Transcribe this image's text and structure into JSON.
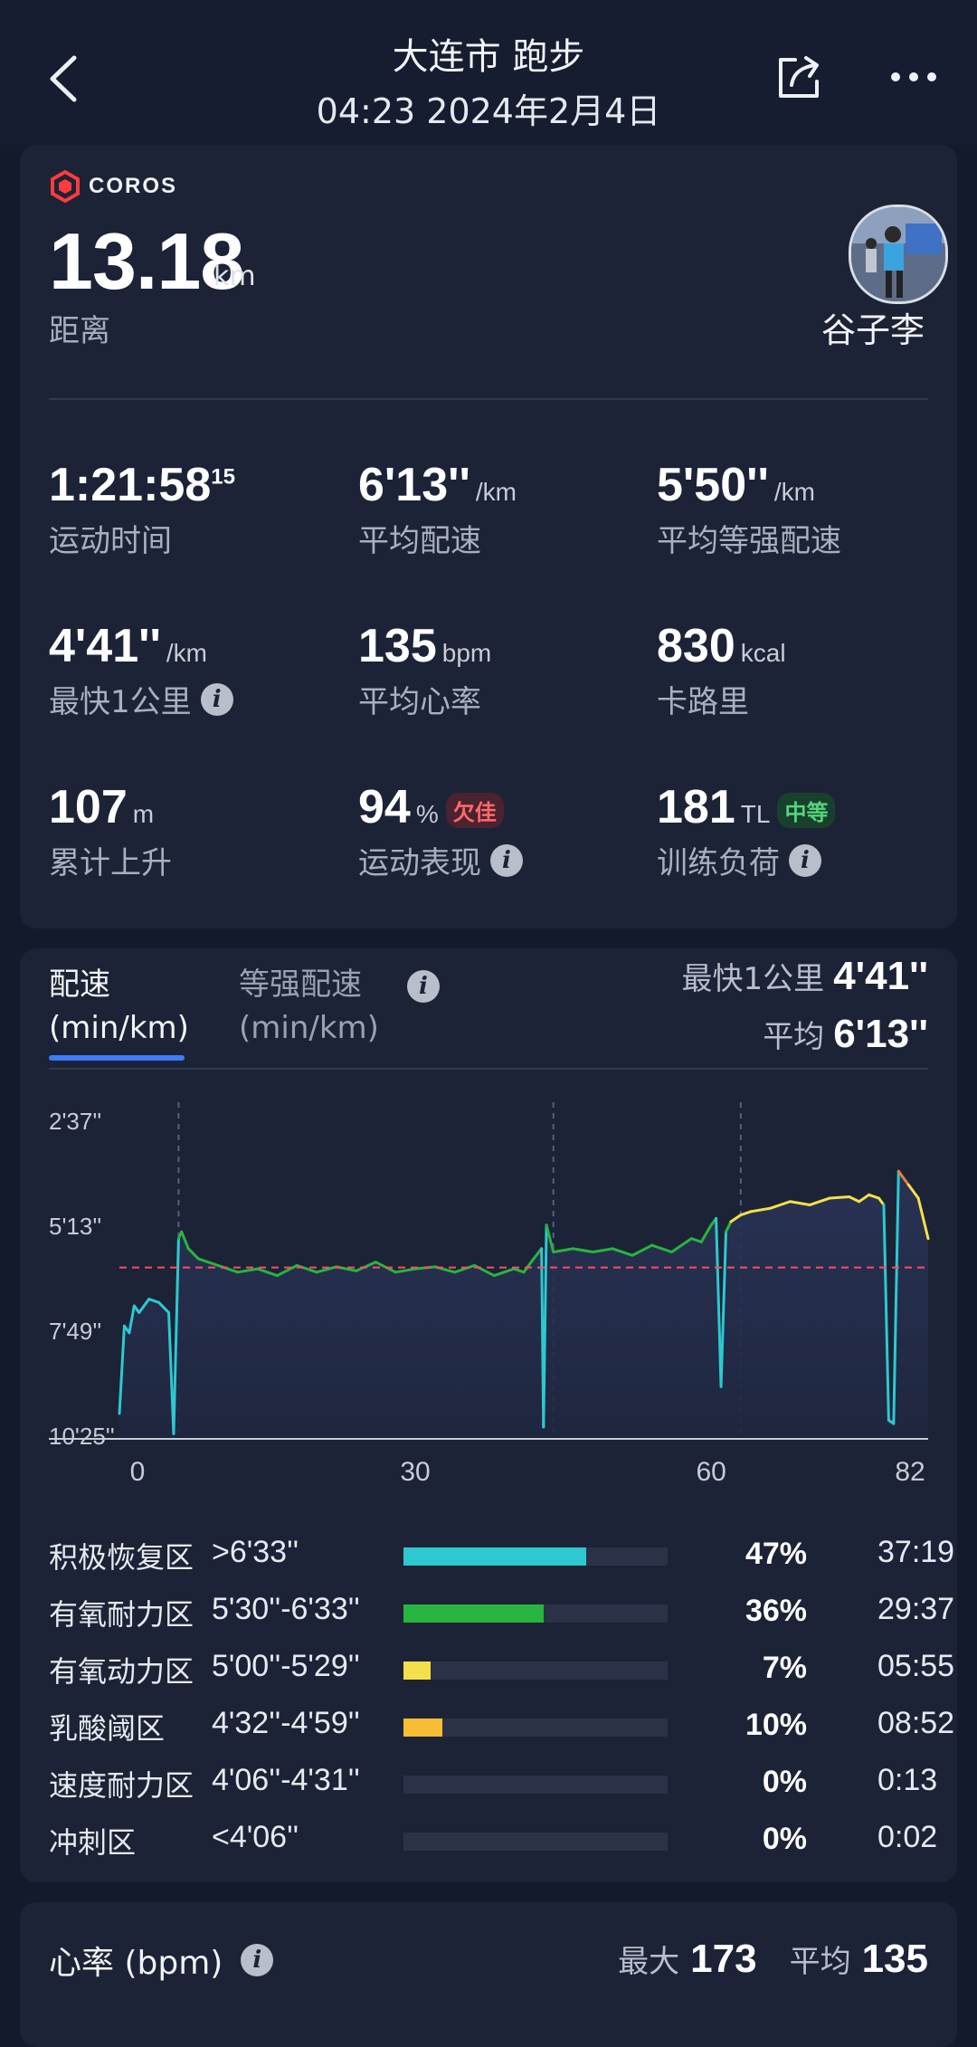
{
  "header": {
    "title": "大连市 跑步",
    "subtitle": "04:23 2024年2月4日"
  },
  "summary": {
    "brand": "COROS",
    "distance": "13.18",
    "distance_unit": "km",
    "distance_label": "距离",
    "username": "谷子李",
    "stats": [
      {
        "value": "1:21:58",
        "sup": "15",
        "unit": "",
        "label": "运动时间"
      },
      {
        "value": "6'13''",
        "unit": "/km",
        "label": "平均配速"
      },
      {
        "value": "5'50''",
        "unit": "/km",
        "label": "平均等强配速"
      },
      {
        "value": "4'41''",
        "unit": "/km",
        "label": "最快1公里"
      },
      {
        "value": "135",
        "unit": "bpm",
        "label": "平均心率"
      },
      {
        "value": "830",
        "unit": "kcal",
        "label": "卡路里"
      },
      {
        "value": "107",
        "unit": "m",
        "label": "累计上升"
      },
      {
        "value": "94",
        "unit": "%",
        "badge": "欠佳",
        "label": "运动表现"
      },
      {
        "value": "181",
        "unit": "TL",
        "badge": "中等",
        "label": "训练负荷"
      }
    ]
  },
  "pace": {
    "tab1_line1": "配速",
    "tab1_line2": "(min/km)",
    "tab2_line1": "等强配速",
    "tab2_line2": "(min/km)",
    "fastest_label": "最快1公里",
    "fastest_value": "4'41''",
    "avg_label": "平均",
    "avg_value": "6'13''"
  },
  "chart_data": {
    "type": "line",
    "title": "",
    "xlabel": "",
    "ylabel": "配速 (min/km)",
    "x_ticks": [
      "0",
      "30",
      "60",
      "82"
    ],
    "x_tick_values": [
      0,
      30,
      60,
      82
    ],
    "y_ticks": [
      "2'37''",
      "5'13''",
      "7'49''",
      "10'25''"
    ],
    "y_tick_values_sec": [
      157,
      313,
      469,
      625
    ],
    "ylim_sec": [
      157,
      625
    ],
    "xlim": [
      0,
      82
    ],
    "y_inverted": true,
    "average_line_sec": 373,
    "x": [
      0,
      0.5,
      1,
      1.5,
      2,
      3,
      4,
      5,
      5.5,
      6,
      6.3,
      7,
      8,
      10,
      12,
      14,
      16,
      18,
      20,
      22,
      24,
      26,
      28,
      30,
      32,
      34,
      36,
      38,
      40,
      41,
      42,
      42.8,
      43,
      43.3,
      44,
      46,
      48,
      50,
      52,
      54,
      56,
      58,
      59,
      60,
      60.5,
      61,
      61.5,
      62,
      63,
      64,
      66,
      68,
      70,
      72,
      74,
      75,
      76,
      77,
      77.5,
      78,
      78.5,
      79,
      80,
      81,
      82
    ],
    "y": [
      590,
      460,
      470,
      430,
      440,
      420,
      425,
      440,
      620,
      330,
      320,
      345,
      360,
      370,
      380,
      375,
      385,
      370,
      380,
      372,
      378,
      365,
      380,
      375,
      372,
      380,
      370,
      385,
      375,
      380,
      360,
      345,
      610,
      310,
      350,
      345,
      350,
      345,
      355,
      340,
      350,
      330,
      335,
      310,
      300,
      550,
      320,
      305,
      295,
      290,
      285,
      275,
      280,
      270,
      268,
      275,
      265,
      270,
      280,
      600,
      605,
      230,
      250,
      270,
      330
    ],
    "zones": [
      {
        "name": "积极恢复区",
        "range": ">6'33''",
        "percent": 47,
        "pct_text": "47%",
        "time": "37:19",
        "color": "#2ec8d0"
      },
      {
        "name": "有氧耐力区",
        "range": "5'30''-6'33''",
        "percent": 36,
        "pct_text": "36%",
        "time": "29:37",
        "color": "#27b53f"
      },
      {
        "name": "有氧动力区",
        "range": "5'00''-5'29''",
        "percent": 7,
        "pct_text": "7%",
        "time": "05:55",
        "color": "#f5e04a"
      },
      {
        "name": "乳酸阈区",
        "range": "4'32''-4'59''",
        "percent": 10,
        "pct_text": "10%",
        "time": "08:52",
        "color": "#f6bd35"
      },
      {
        "name": "速度耐力区",
        "range": "4'06''-4'31''",
        "percent": 0,
        "pct_text": "0%",
        "time": "0:13",
        "color": "#ef7a3a"
      },
      {
        "name": "冲刺区",
        "range": "<4'06''",
        "percent": 0,
        "pct_text": "0%",
        "time": "0:02",
        "color": "#e84848"
      }
    ]
  },
  "hr": {
    "title": "心率 (bpm)",
    "max_label": "最大",
    "max_value": "173",
    "avg_label": "平均",
    "avg_value": "135"
  },
  "colors": {
    "background": "#131a2b",
    "card": "#1c2336",
    "accent": "#3d7bff",
    "avg_line": "#ff4d5e"
  }
}
